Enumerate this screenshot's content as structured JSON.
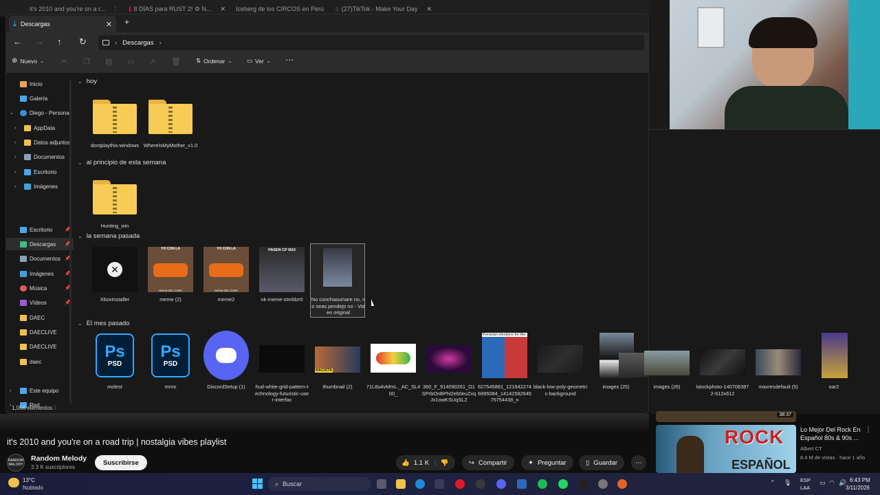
{
  "browser_tabs": [
    {
      "label": "it's 2010 and you're on a r..."
    },
    {
      "label": "8 DÍAS para RUST 2! ⚙ N..."
    },
    {
      "label": "Iceberg de los CIRCOS en Perú"
    },
    {
      "label": "(27)TikTok - Make Your Day"
    }
  ],
  "explorer": {
    "tab_title": "Descargas",
    "address": "Descargas",
    "toolbar": {
      "new": "Nuevo",
      "sort": "Ordenar",
      "view": "Ver"
    },
    "sidebar": {
      "home": "Inicio",
      "gallery": "Galería",
      "personal": "Diego - Personal",
      "appdata": "AppData",
      "attachments": "Datos adjuntos",
      "documents": "Documentos",
      "desktop": "Escritorio",
      "images": "Imágenes",
      "q_desktop": "Escritorio",
      "q_downloads": "Descargas",
      "q_documents": "Documentos",
      "q_images": "Imágenes",
      "q_music": "Música",
      "q_videos": "Vídeos",
      "daec1": "DAEC",
      "daec2": "DAECLIVE",
      "daec3": "DAECLIVE",
      "daec4": "daec",
      "this_pc": "Este equipo",
      "network": "Red"
    },
    "groups": {
      "today": "hoy",
      "this_week": "al principio de esta semana",
      "last_week": "la semana pasada",
      "last_month": "El mes pasado"
    },
    "files_today": [
      "dontplaythis-windows",
      "WhereIsMyMother_v1.0"
    ],
    "files_week": [
      "Hunting_win"
    ],
    "files_last_week": [
      "XboxInstaller",
      "meme (2)",
      "meme2",
      "nk-meme-stmldzr0",
      "No conchasumare no, no seas pendejo no - Video original"
    ],
    "files_last_month": [
      "molest",
      "mrmr",
      "DiscordSetup (1)",
      "hud-white-grid-pattern-technology-futuristic-user-interfac",
      "thumbnail (2)",
      "71L8u4vMmL._AC_SL400_",
      "360_F_914090261_O1SPrbOnBPN2e60euZxqJx1owKSUqSLZ",
      "627545881_1219422746995084_1414258264575754438_n",
      "black-low-poly-geometric-background",
      "images (25)",
      "images (26)",
      "istockphoto-1407063872-612x612",
      "maxresdefault (5)",
      "oar2"
    ],
    "thumb_text": {
      "meme_top": "YO CON LA",
      "meme_bottom": "NOKIA DEL CURE",
      "nk_top": "PASEN CP M10",
      "psd": "Ps",
      "psd_sub": "PSD",
      "elections": "Peruvian elections be like:",
      "racista": "RACISTA"
    },
    "status": "1,056 elementos"
  },
  "youtube": {
    "video_title": "it's 2010 and you're on a road trip | nostalgia vibes playlist",
    "channel_name": "Random Melody",
    "channel_subs": "3.3 K suscriptores",
    "avatar_text": "RANDOM MELODY",
    "subscribe": "Suscribirse",
    "likes": "1.1 K",
    "share": "Compartir",
    "ask": "Preguntar",
    "save": "Guardar",
    "rec_duration": "38:37",
    "rec_title": "Lo Mejor Del Rock En Español 80s & 90s ...",
    "rec_author": "Albert CT",
    "rec_meta": "8.4 M de vistas · hace 1 año",
    "rec_thumb_text1": "ROCK",
    "rec_thumb_text2": "ESPAÑOL"
  },
  "taskbar": {
    "temp": "13°C",
    "weather": "Nublado",
    "search": "Buscar",
    "lang1": "ESP",
    "lang2": "LAA",
    "time": "6:43 PM",
    "date": "3/11/2026"
  }
}
